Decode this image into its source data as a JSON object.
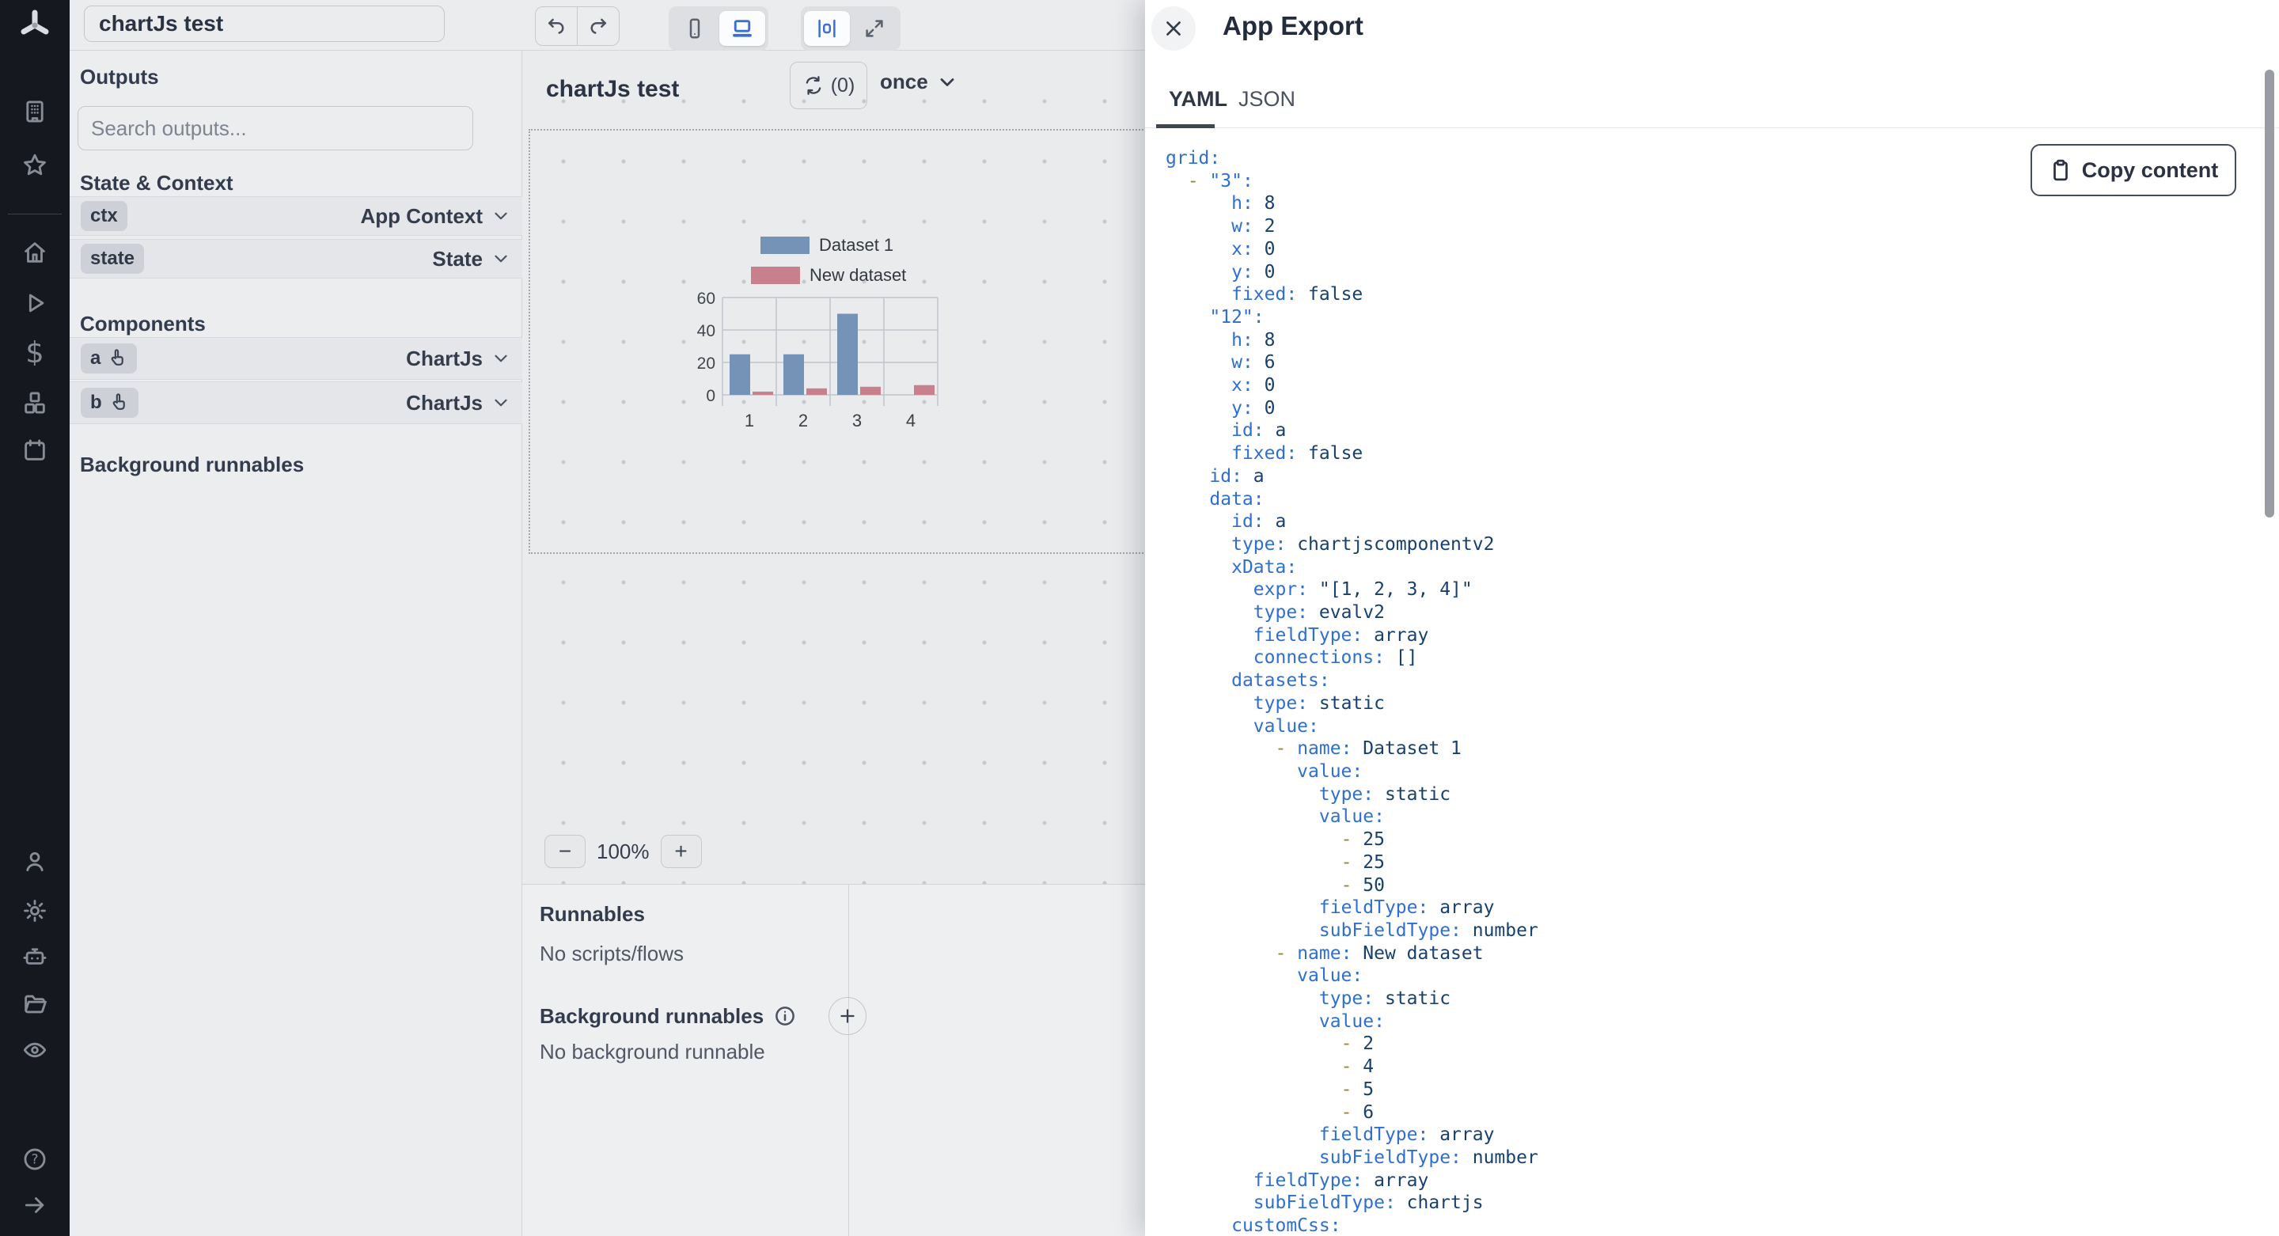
{
  "topbar": {
    "title_value": "chartJs test"
  },
  "rail": {
    "icons": [
      "building",
      "star",
      "home",
      "play",
      "dollar",
      "cubes",
      "calendar",
      "user",
      "gear",
      "robot",
      "folder",
      "eye",
      "help",
      "arrow-right"
    ]
  },
  "outputs_panel": {
    "title": "Outputs",
    "search_placeholder": "Search outputs...",
    "state_context_title": "State & Context",
    "rows": [
      {
        "badge": "ctx",
        "type": "App Context"
      },
      {
        "badge": "state",
        "type": "State"
      }
    ],
    "components_title": "Components",
    "component_rows": [
      {
        "badge": "a",
        "type": "ChartJs"
      },
      {
        "badge": "b",
        "type": "ChartJs"
      }
    ],
    "background_title": "Background runnables"
  },
  "canvas": {
    "title": "chartJs test",
    "refresh_count": "(0)",
    "refresh_mode": "once",
    "zoom_level": "100%",
    "minus_label": "−",
    "plus_label": "+"
  },
  "bottom_panel": {
    "runnables_title": "Runnables",
    "runnables_empty": "No scripts/flows",
    "background_title": "Background runnables",
    "background_empty": "No background runnable"
  },
  "export_drawer": {
    "title": "App Export",
    "tabs": [
      {
        "label": "YAML",
        "active": true
      },
      {
        "label": "JSON",
        "active": false
      }
    ],
    "copy_label": "Copy content",
    "code_lines": [
      [
        [
          "k",
          "grid:"
        ]
      ],
      [
        [
          "p",
          "  "
        ],
        [
          "d",
          "- "
        ],
        [
          "k",
          "\"3\":"
        ]
      ],
      [
        [
          "p",
          "      "
        ],
        [
          "k",
          "h:"
        ],
        [
          "v",
          " 8"
        ]
      ],
      [
        [
          "p",
          "      "
        ],
        [
          "k",
          "w:"
        ],
        [
          "v",
          " 2"
        ]
      ],
      [
        [
          "p",
          "      "
        ],
        [
          "k",
          "x:"
        ],
        [
          "v",
          " 0"
        ]
      ],
      [
        [
          "p",
          "      "
        ],
        [
          "k",
          "y:"
        ],
        [
          "v",
          " 0"
        ]
      ],
      [
        [
          "p",
          "      "
        ],
        [
          "k",
          "fixed:"
        ],
        [
          "v",
          " false"
        ]
      ],
      [
        [
          "p",
          "    "
        ],
        [
          "k",
          "\"12\":"
        ]
      ],
      [
        [
          "p",
          "      "
        ],
        [
          "k",
          "h:"
        ],
        [
          "v",
          " 8"
        ]
      ],
      [
        [
          "p",
          "      "
        ],
        [
          "k",
          "w:"
        ],
        [
          "v",
          " 6"
        ]
      ],
      [
        [
          "p",
          "      "
        ],
        [
          "k",
          "x:"
        ],
        [
          "v",
          " 0"
        ]
      ],
      [
        [
          "p",
          "      "
        ],
        [
          "k",
          "y:"
        ],
        [
          "v",
          " 0"
        ]
      ],
      [
        [
          "p",
          "      "
        ],
        [
          "k",
          "id:"
        ],
        [
          "v",
          " a"
        ]
      ],
      [
        [
          "p",
          "      "
        ],
        [
          "k",
          "fixed:"
        ],
        [
          "v",
          " false"
        ]
      ],
      [
        [
          "p",
          "    "
        ],
        [
          "k",
          "id:"
        ],
        [
          "v",
          " a"
        ]
      ],
      [
        [
          "p",
          "    "
        ],
        [
          "k",
          "data:"
        ]
      ],
      [
        [
          "p",
          "      "
        ],
        [
          "k",
          "id:"
        ],
        [
          "v",
          " a"
        ]
      ],
      [
        [
          "p",
          "      "
        ],
        [
          "k",
          "type:"
        ],
        [
          "v",
          " chartjscomponentv2"
        ]
      ],
      [
        [
          "p",
          "      "
        ],
        [
          "k",
          "xData:"
        ]
      ],
      [
        [
          "p",
          "        "
        ],
        [
          "k",
          "expr:"
        ],
        [
          "v",
          " \"[1, 2, 3, 4]\""
        ]
      ],
      [
        [
          "p",
          "        "
        ],
        [
          "k",
          "type:"
        ],
        [
          "v",
          " evalv2"
        ]
      ],
      [
        [
          "p",
          "        "
        ],
        [
          "k",
          "fieldType:"
        ],
        [
          "v",
          " array"
        ]
      ],
      [
        [
          "p",
          "        "
        ],
        [
          "k",
          "connections:"
        ],
        [
          "v",
          " []"
        ]
      ],
      [
        [
          "p",
          "      "
        ],
        [
          "k",
          "datasets:"
        ]
      ],
      [
        [
          "p",
          "        "
        ],
        [
          "k",
          "type:"
        ],
        [
          "v",
          " static"
        ]
      ],
      [
        [
          "p",
          "        "
        ],
        [
          "k",
          "value:"
        ]
      ],
      [
        [
          "p",
          "          "
        ],
        [
          "d",
          "- "
        ],
        [
          "k",
          "name:"
        ],
        [
          "v",
          " Dataset 1"
        ]
      ],
      [
        [
          "p",
          "            "
        ],
        [
          "k",
          "value:"
        ]
      ],
      [
        [
          "p",
          "              "
        ],
        [
          "k",
          "type:"
        ],
        [
          "v",
          " static"
        ]
      ],
      [
        [
          "p",
          "              "
        ],
        [
          "k",
          "value:"
        ]
      ],
      [
        [
          "p",
          "                "
        ],
        [
          "d",
          "- "
        ],
        [
          "v",
          "25"
        ]
      ],
      [
        [
          "p",
          "                "
        ],
        [
          "d",
          "- "
        ],
        [
          "v",
          "25"
        ]
      ],
      [
        [
          "p",
          "                "
        ],
        [
          "d",
          "- "
        ],
        [
          "v",
          "50"
        ]
      ],
      [
        [
          "p",
          "              "
        ],
        [
          "k",
          "fieldType:"
        ],
        [
          "v",
          " array"
        ]
      ],
      [
        [
          "p",
          "              "
        ],
        [
          "k",
          "subFieldType:"
        ],
        [
          "v",
          " number"
        ]
      ],
      [
        [
          "p",
          "          "
        ],
        [
          "d",
          "- "
        ],
        [
          "k",
          "name:"
        ],
        [
          "v",
          " New dataset"
        ]
      ],
      [
        [
          "p",
          "            "
        ],
        [
          "k",
          "value:"
        ]
      ],
      [
        [
          "p",
          "              "
        ],
        [
          "k",
          "type:"
        ],
        [
          "v",
          " static"
        ]
      ],
      [
        [
          "p",
          "              "
        ],
        [
          "k",
          "value:"
        ]
      ],
      [
        [
          "p",
          "                "
        ],
        [
          "d",
          "- "
        ],
        [
          "v",
          "2"
        ]
      ],
      [
        [
          "p",
          "                "
        ],
        [
          "d",
          "- "
        ],
        [
          "v",
          "4"
        ]
      ],
      [
        [
          "p",
          "                "
        ],
        [
          "d",
          "- "
        ],
        [
          "v",
          "5"
        ]
      ],
      [
        [
          "p",
          "                "
        ],
        [
          "d",
          "- "
        ],
        [
          "v",
          "6"
        ]
      ],
      [
        [
          "p",
          "              "
        ],
        [
          "k",
          "fieldType:"
        ],
        [
          "v",
          " array"
        ]
      ],
      [
        [
          "p",
          "              "
        ],
        [
          "k",
          "subFieldType:"
        ],
        [
          "v",
          " number"
        ]
      ],
      [
        [
          "p",
          "        "
        ],
        [
          "k",
          "fieldType:"
        ],
        [
          "v",
          " array"
        ]
      ],
      [
        [
          "p",
          "        "
        ],
        [
          "k",
          "subFieldType:"
        ],
        [
          "v",
          " chartjs"
        ]
      ],
      [
        [
          "p",
          "      "
        ],
        [
          "k",
          "customCss:"
        ]
      ]
    ]
  },
  "chart_data": {
    "type": "bar",
    "title": "",
    "categories": [
      "1",
      "2",
      "3",
      "4"
    ],
    "series": [
      {
        "name": "Dataset 1",
        "color": "#7593b6",
        "values": [
          25,
          25,
          50,
          null
        ]
      },
      {
        "name": "New dataset",
        "color": "#c9808d",
        "values": [
          2,
          4,
          5,
          6
        ]
      }
    ],
    "yticks": [
      0,
      20,
      40,
      60
    ],
    "ylim": [
      0,
      60
    ],
    "xlabel": "",
    "ylabel": "",
    "grid": true,
    "legend_position": "top"
  },
  "colors": {
    "accent_blue": "#3b6fd4",
    "code_key": "#2e6fd0",
    "code_value": "#17406f",
    "code_dash": "#9a8434",
    "chart_blue": "#7593b6",
    "chart_pink": "#c9808d"
  }
}
